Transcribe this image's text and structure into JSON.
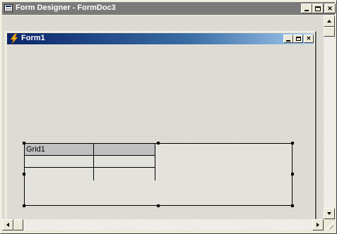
{
  "app_window": {
    "title": "Form Designer - FormDoc3",
    "buttons": {
      "minimize": "_",
      "maximize": "□",
      "close": "✕"
    }
  },
  "form_window": {
    "title": "Form1",
    "icon": "form-lightning-icon",
    "buttons": {
      "minimize": "_",
      "maximize": "□",
      "close": "✕"
    }
  },
  "grid": {
    "name": "Grid1",
    "headers": [
      "Grid1",
      ""
    ],
    "rows": [
      [
        "",
        ""
      ],
      [
        "",
        ""
      ]
    ]
  },
  "scrollbars": {
    "vertical": "scrollbar-vertical",
    "horizontal": "scrollbar-horizontal"
  },
  "colors": {
    "active_title_start": "#0a246a",
    "active_title_end": "#a6caf0",
    "inactive_title": "#7a7a7a",
    "face": "#ece9d8"
  }
}
